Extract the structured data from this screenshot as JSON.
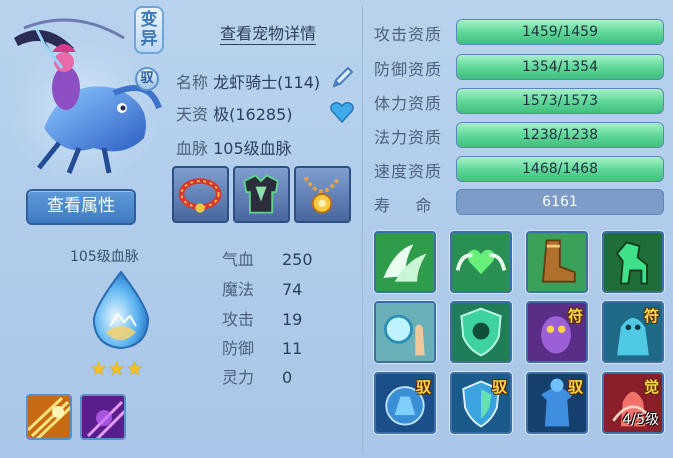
{
  "pet": {
    "mutation_label": "变异",
    "yu_label": "驭",
    "view_details": "查看宠物详情",
    "name_label": "名称",
    "name_value": "龙虾骑士(114)",
    "talent_label": "天资",
    "talent_value": "极(16285)",
    "bloodline_label": "血脉",
    "bloodline_value": "105级血脉",
    "view_attributes": "查看属性",
    "bloodline_badge": "105级血脉",
    "stars": "★★★"
  },
  "stats": [
    {
      "label": "气血",
      "value": "250"
    },
    {
      "label": "魔法",
      "value": "74"
    },
    {
      "label": "攻击",
      "value": "19"
    },
    {
      "label": "防御",
      "value": "11"
    },
    {
      "label": "灵力",
      "value": "0"
    }
  ],
  "aptitudes": [
    {
      "label": "攻击资质",
      "value": "1459/1459",
      "fill": 1.0
    },
    {
      "label": "防御资质",
      "value": "1354/1354",
      "fill": 1.0
    },
    {
      "label": "体力资质",
      "value": "1573/1573",
      "fill": 1.0
    },
    {
      "label": "法力资质",
      "value": "1238/1238",
      "fill": 1.0
    },
    {
      "label": "速度资质",
      "value": "1468/1468",
      "fill": 1.0
    }
  ],
  "lifespan": {
    "label": "寿    命",
    "value": "6161"
  },
  "skills": {
    "row3": [
      {
        "tag": "符"
      },
      {
        "tag": "符"
      }
    ],
    "row4": [
      {
        "tag": "驭"
      },
      {
        "tag": "驭"
      },
      {
        "tag": "驭"
      },
      {
        "tag": "觉",
        "level": "4/5级"
      }
    ]
  },
  "colors": {
    "accent_green": "#61d89a",
    "panel_bg": "#b9d3ee",
    "button_blue": "#3f7ac0",
    "star_gold": "#f4c21b"
  },
  "icons": [
    "pet-portrait",
    "edit-icon",
    "heart-icon",
    "water-drop-icon",
    "necklace-icon",
    "armor-icon",
    "amulet-icon"
  ]
}
